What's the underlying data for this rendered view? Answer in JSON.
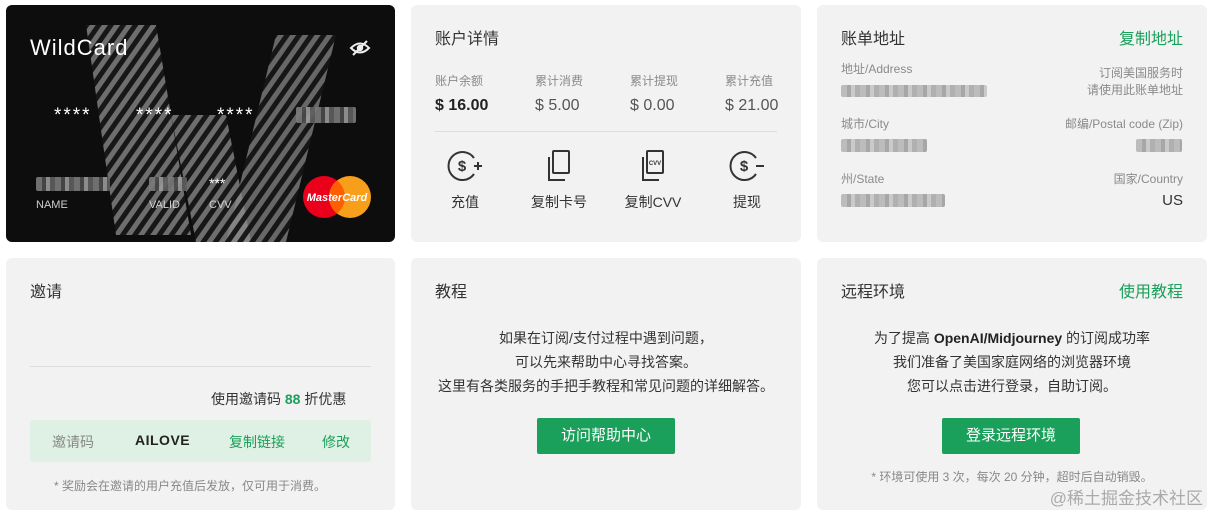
{
  "card": {
    "brand": "WildCard",
    "masked": [
      "****",
      "****",
      "****"
    ],
    "name_label": "NAME",
    "valid_label": "VALID",
    "cvv_label": "CVV",
    "cvv_value": "***",
    "network": "MasterCard"
  },
  "account": {
    "title": "账户详情",
    "stats": [
      {
        "label": "账户余额",
        "value": "$ 16.00"
      },
      {
        "label": "累计消费",
        "value": "$ 5.00"
      },
      {
        "label": "累计提现",
        "value": "$ 0.00"
      },
      {
        "label": "累计充值",
        "value": "$ 21.00"
      }
    ],
    "actions": [
      {
        "label": "充值",
        "icon": "dollar-plus-icon"
      },
      {
        "label": "复制卡号",
        "icon": "copy-card-icon"
      },
      {
        "label": "复制CVV",
        "icon": "copy-cvv-icon"
      },
      {
        "label": "提现",
        "icon": "dollar-minus-icon"
      }
    ],
    "cvv_icon_text": "CVV"
  },
  "billing": {
    "title": "账单地址",
    "copy_link": "复制地址",
    "address_label": "地址/Address",
    "address_note_1": "订阅美国服务时",
    "address_note_2": "请使用此账单地址",
    "city_label": "城市/City",
    "zip_label": "邮编/Postal code (Zip)",
    "state_label": "州/State",
    "country_label": "国家/Country",
    "country_value": "US"
  },
  "invite": {
    "title": "邀请",
    "discount_prefix": "使用邀请码 ",
    "discount_num": "88",
    "discount_suffix": " 折优惠",
    "code_label": "邀请码",
    "code_value": "AILOVE",
    "copy_link": "复制链接",
    "edit": "修改",
    "note": "* 奖励会在邀请的用户充值后发放，仅可用于消费。"
  },
  "tutorial": {
    "title": "教程",
    "line1": "如果在订阅/支付过程中遇到问题，",
    "line2": "可以先来帮助中心寻找答案。",
    "line3": "这里有各类服务的手把手教程和常见问题的详细解答。",
    "button": "访问帮助中心"
  },
  "remote": {
    "title": "远程环境",
    "link": "使用教程",
    "line1_prefix": "为了提高 ",
    "line1_bold": "OpenAI/Midjourney",
    "line1_suffix": " 的订阅成功率",
    "line2": "我们准备了美国家庭网络的浏览器环境",
    "line3": "您可以点击进行登录，自助订阅。",
    "button": "登录远程环境",
    "note": "* 环境可使用 3 次，每次 20 分钟，超时后自动销毁。"
  },
  "watermark": "@稀土掘金技术社区",
  "colors": {
    "accent": "#1aa05a",
    "panel": "#f2f2f2",
    "card": "#0d0d0d"
  }
}
